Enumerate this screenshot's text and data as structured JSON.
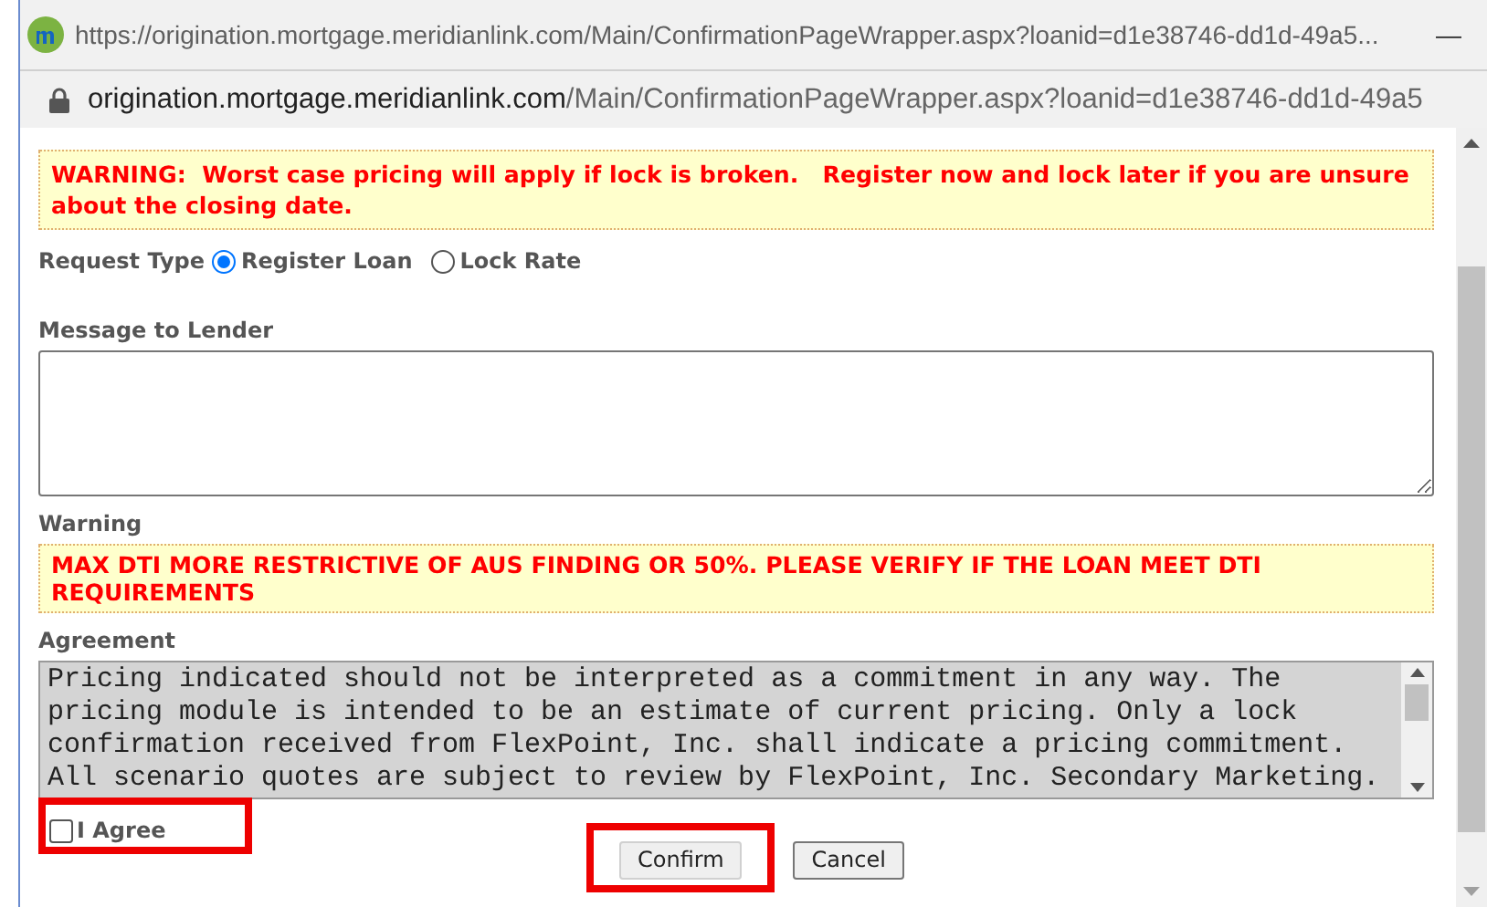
{
  "window": {
    "title": "https://origination.mortgage.meridianlink.com/Main/ConfirmationPageWrapper.aspx?loanid=d1e38746-dd1d-49a5...",
    "minimize": "—"
  },
  "address_bar": {
    "url_host": "origination.mortgage.meridianlink.com",
    "url_path": "/Main/ConfirmationPageWrapper.aspx?loanid=d1e38746-dd1d-49a5"
  },
  "top_warning": "WARNING:  Worst case pricing will apply if lock is broken.   Register now and lock later if you are unsure about the closing date.",
  "request_type": {
    "label": "Request Type",
    "options": [
      {
        "label": "Register Loan",
        "selected": true
      },
      {
        "label": "Lock Rate",
        "selected": false
      }
    ]
  },
  "message_to_lender": {
    "label": "Message to Lender"
  },
  "warning": {
    "label": "Warning",
    "text": "MAX DTI MORE RESTRICTIVE OF AUS FINDING OR 50%. PLEASE VERIFY IF THE LOAN MEET DTI REQUIREMENTS"
  },
  "agreement": {
    "label": "Agreement",
    "text": "Pricing indicated should not be interpreted as a commitment in any way. The pricing module is intended to be an estimate of current pricing. Only a lock confirmation received from FlexPoint, Inc. shall indicate a pricing commitment. All scenario quotes are subject to review by FlexPoint, Inc. Secondary Marketing."
  },
  "agree": {
    "label": "I Agree",
    "checked": false,
    "highlighted": true
  },
  "buttons": [
    {
      "label": "Confirm",
      "highlighted": true
    },
    {
      "label": "Cancel",
      "highlighted": false
    }
  ]
}
